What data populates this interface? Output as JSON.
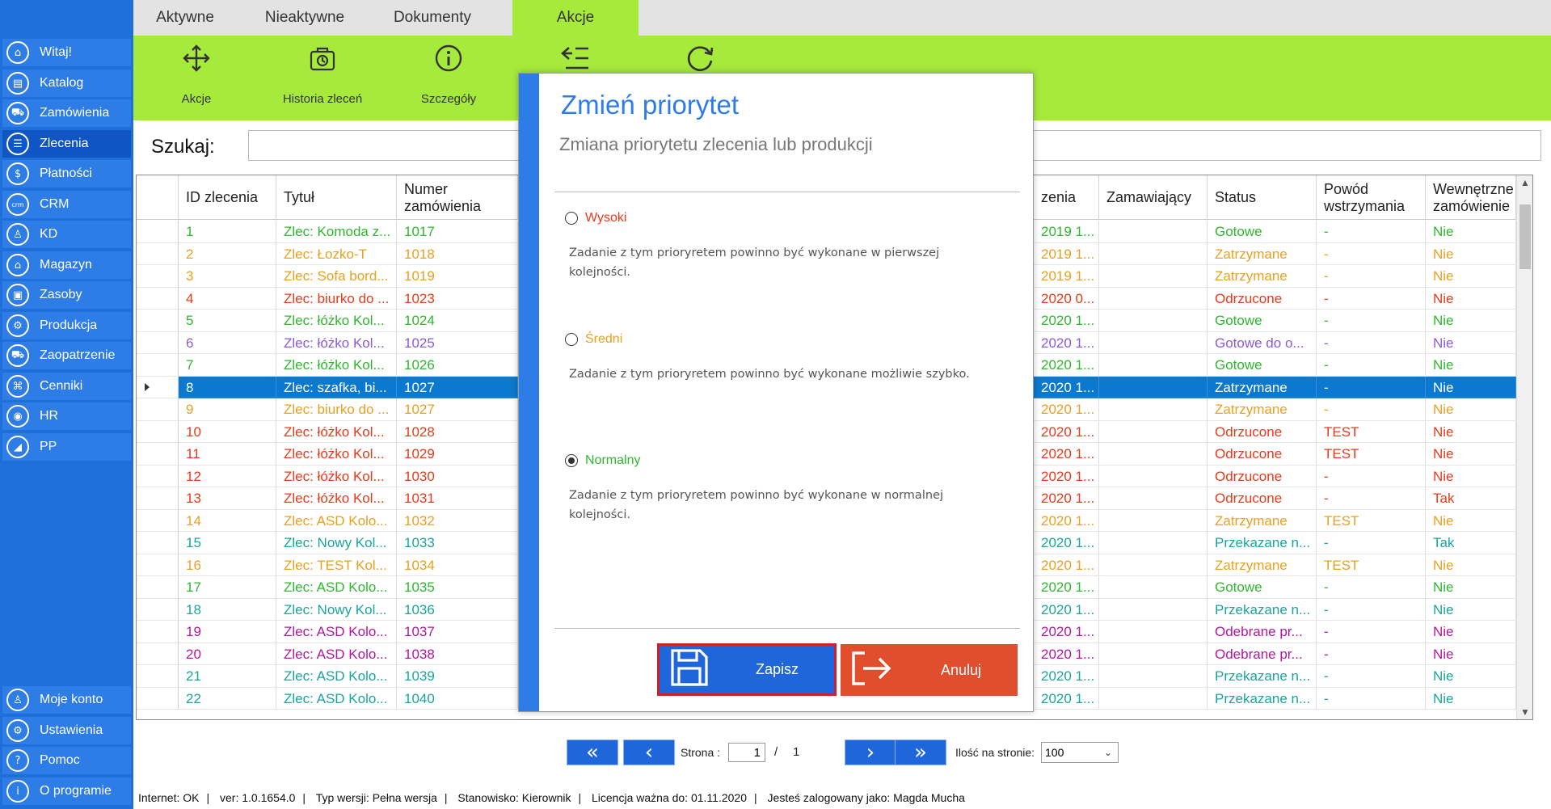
{
  "sidebar": {
    "items": [
      {
        "label": "Witaj!",
        "icon": "home-icon",
        "glyph": "⌂"
      },
      {
        "label": "Katalog",
        "icon": "book-icon",
        "glyph": "▤"
      },
      {
        "label": "Zamówienia",
        "icon": "cart-icon",
        "glyph": "⛟"
      },
      {
        "label": "Zlecenia",
        "icon": "list-icon",
        "glyph": "☰"
      },
      {
        "label": "Płatności",
        "icon": "dollar-icon",
        "glyph": "$"
      },
      {
        "label": "CRM",
        "icon": "crm-icon",
        "glyph": "crm"
      },
      {
        "label": "KD",
        "icon": "user-icon",
        "glyph": "♙"
      },
      {
        "label": "Magazyn",
        "icon": "warehouse-icon",
        "glyph": "⌂"
      },
      {
        "label": "Zasoby",
        "icon": "box-icon",
        "glyph": "▣"
      },
      {
        "label": "Produkcja",
        "icon": "production-icon",
        "glyph": "⚙"
      },
      {
        "label": "Zaopatrzenie",
        "icon": "truck-icon",
        "glyph": "⛟"
      },
      {
        "label": "Cenniki",
        "icon": "tag-icon",
        "glyph": "⌘"
      },
      {
        "label": "HR",
        "icon": "people-icon",
        "glyph": "◉"
      },
      {
        "label": "PP",
        "icon": "chart-icon",
        "glyph": "◢"
      }
    ],
    "bottom": [
      {
        "label": "Moje konto",
        "icon": "account-icon",
        "glyph": "♙"
      },
      {
        "label": "Ustawienia",
        "icon": "settings-icon",
        "glyph": "⚙"
      },
      {
        "label": "Pomoc",
        "icon": "help-icon",
        "glyph": "?"
      },
      {
        "label": "O programie",
        "icon": "info-icon",
        "glyph": "i"
      }
    ]
  },
  "tabs": [
    "Aktywne",
    "Nieaktywne",
    "Dokumenty",
    "Akcje"
  ],
  "ribbon": [
    {
      "label": "Akcje",
      "icon": "move-arrows-icon"
    },
    {
      "label": "Historia zleceń",
      "icon": "history-bag-icon"
    },
    {
      "label": "Szczegóły",
      "icon": "info-circle-icon"
    },
    {
      "label": "",
      "icon": "priority-list-icon"
    },
    {
      "label": "",
      "icon": "refresh-icon"
    }
  ],
  "search": {
    "label": "Szukaj:",
    "value": ""
  },
  "grid": {
    "columns": [
      "ID zlecenia",
      "Tytuł",
      "Numer zamówienia",
      "zenia",
      "Zamawiający",
      "Status",
      "Powód wstrzymania",
      "Wewnętrzne zamówienie"
    ],
    "rows": [
      {
        "id": "1",
        "title": "Zlec: Komoda z...",
        "order": "1017",
        "date": "2019 1...",
        "client": "",
        "status": "Gotowe",
        "reason": "-",
        "internal": "Nie",
        "color": "#2db82d"
      },
      {
        "id": "2",
        "title": "Zlec: Łozko-T",
        "order": "1018",
        "date": "2019 1...",
        "client": "",
        "status": "Zatrzymane",
        "reason": "-",
        "internal": "Nie",
        "color": "#e8a020"
      },
      {
        "id": "3",
        "title": "Zlec: Sofa bord...",
        "order": "1019",
        "date": "2019 1...",
        "client": "",
        "status": "Zatrzymane",
        "reason": "-",
        "internal": "Nie",
        "color": "#e8a020"
      },
      {
        "id": "4",
        "title": "Zlec: biurko do ...",
        "order": "1023",
        "date": "2020 0...",
        "client": "",
        "status": "Odrzucone",
        "reason": "-",
        "internal": "Nie",
        "color": "#e83a1a"
      },
      {
        "id": "5",
        "title": "Zlec: łóżko Kol...",
        "order": "1024",
        "date": "2020 1...",
        "client": "",
        "status": "Gotowe",
        "reason": "-",
        "internal": "Nie",
        "color": "#2db82d"
      },
      {
        "id": "6",
        "title": "Zlec: łóżko Kol...",
        "order": "1025",
        "date": "2020 1...",
        "client": "",
        "status": "Gotowe do o...",
        "reason": "-",
        "internal": "Nie",
        "color": "#8a5ad8"
      },
      {
        "id": "7",
        "title": "Zlec: łóżko Kol...",
        "order": "1026",
        "date": "2020 1...",
        "client": "",
        "status": "Gotowe",
        "reason": "-",
        "internal": "Nie",
        "color": "#2db82d"
      },
      {
        "id": "8",
        "title": "Zlec: szafka, bi...",
        "order": "1027",
        "date": "2020 1...",
        "client": "",
        "status": "Zatrzymane",
        "reason": "-",
        "internal": "Nie",
        "color": "#ffffff"
      },
      {
        "id": "9",
        "title": "Zlec: biurko do ...",
        "order": "1027",
        "date": "2020 1...",
        "client": "",
        "status": "Zatrzymane",
        "reason": "-",
        "internal": "Nie",
        "color": "#e8a020"
      },
      {
        "id": "10",
        "title": "Zlec: łóżko Kol...",
        "order": "1028",
        "date": "2020 1...",
        "client": "",
        "status": "Odrzucone",
        "reason": "TEST",
        "internal": "Nie",
        "color": "#e83a1a"
      },
      {
        "id": "11",
        "title": "Zlec: łóżko Kol...",
        "order": "1029",
        "date": "2020 1...",
        "client": "",
        "status": "Odrzucone",
        "reason": "TEST",
        "internal": "Nie",
        "color": "#e83a1a"
      },
      {
        "id": "12",
        "title": "Zlec: łóżko Kol...",
        "order": "1030",
        "date": "2020 1...",
        "client": "",
        "status": "Odrzucone",
        "reason": "-",
        "internal": "Nie",
        "color": "#e83a1a"
      },
      {
        "id": "13",
        "title": "Zlec: łóżko Kol...",
        "order": "1031",
        "date": "2020 1...",
        "client": "",
        "status": "Odrzucone",
        "reason": "-",
        "internal": "Tak",
        "color": "#e83a1a"
      },
      {
        "id": "14",
        "title": "Zlec: ASD Kolo...",
        "order": "1032",
        "date": "2020 1...",
        "client": "",
        "status": "Zatrzymane",
        "reason": "TEST",
        "internal": "Nie",
        "color": "#e8a020"
      },
      {
        "id": "15",
        "title": "Zlec: Nowy Kol...",
        "order": "1033",
        "date": "2020 1...",
        "client": "",
        "status": "Przekazane n...",
        "reason": "-",
        "internal": "Tak",
        "color": "#1aa59a"
      },
      {
        "id": "16",
        "title": "Zlec: TEST Kol...",
        "order": "1034",
        "date": "2020 1...",
        "client": "",
        "status": "Zatrzymane",
        "reason": "TEST",
        "internal": "Nie",
        "color": "#e8a020"
      },
      {
        "id": "17",
        "title": "Zlec: ASD Kolo...",
        "order": "1035",
        "date": "2020 1...",
        "client": "",
        "status": "Gotowe",
        "reason": "-",
        "internal": "Nie",
        "color": "#2db82d"
      },
      {
        "id": "18",
        "title": "Zlec: Nowy Kol...",
        "order": "1036",
        "date": "2020 1...",
        "client": "",
        "status": "Przekazane n...",
        "reason": "-",
        "internal": "Nie",
        "color": "#1aa59a"
      },
      {
        "id": "19",
        "title": "Zlec: ASD Kolo...",
        "order": "1037",
        "date": "2020 1...",
        "client": "",
        "status": "Odebrane pr...",
        "reason": "-",
        "internal": "Nie",
        "color": "#b0189e"
      },
      {
        "id": "20",
        "title": "Zlec: ASD Kolo...",
        "order": "1038",
        "date": "2020 1...",
        "client": "",
        "status": "Odebrane pr...",
        "reason": "-",
        "internal": "Nie",
        "color": "#b0189e"
      },
      {
        "id": "21",
        "title": "Zlec: ASD Kolo...",
        "order": "1039",
        "date": "2020 1...",
        "client": "",
        "status": "Przekazane n...",
        "reason": "-",
        "internal": "Nie",
        "color": "#1aa59a"
      },
      {
        "id": "22",
        "title": "Zlec: ASD Kolo...",
        "order": "1040",
        "date": "2020 1...",
        "client": "",
        "status": "Przekazane n...",
        "reason": "-",
        "internal": "Nie",
        "color": "#1aa59a"
      }
    ]
  },
  "pager": {
    "page_label": "Strona :",
    "page": "1",
    "slash": "/",
    "total": "1",
    "per_page_label": "Ilość na stronie:",
    "per_page": "100"
  },
  "statusbar": [
    "Internet: OK",
    "ver: 1.0.1654.0",
    "Typ wersji: Pełna wersja",
    "Stanowisko: Kierownik",
    "Licencja ważna do: 01.11.2020",
    "Jesteś zalogowany jako: Magda Mucha"
  ],
  "dialog": {
    "title": "Zmień priorytet",
    "subtitle": "Zmiana priorytetu zlecenia lub produkcji",
    "options": [
      {
        "label": "Wysoki",
        "desc": "Zadanie z tym prioryretem powinno być wykonane w pierwszej kolejności.",
        "color": "#e83a1a",
        "checked": false
      },
      {
        "label": "Średni",
        "desc": "Zadanie z tym prioryretem powinno być wykonane możliwie szybko.",
        "color": "#e8a020",
        "checked": false
      },
      {
        "label": "Normalny",
        "desc": "Zadanie z tym prioryretem powinno być wykonane w normalnej kolejności.",
        "color": "#2db82d",
        "checked": true
      }
    ],
    "save_label": "Zapisz",
    "cancel_label": "Anuluj"
  },
  "colors": {
    "accent": "#2e7ce6",
    "ribbon": "#a6ea3c",
    "selection": "#0b79d0",
    "cancel": "#e04e2e"
  }
}
